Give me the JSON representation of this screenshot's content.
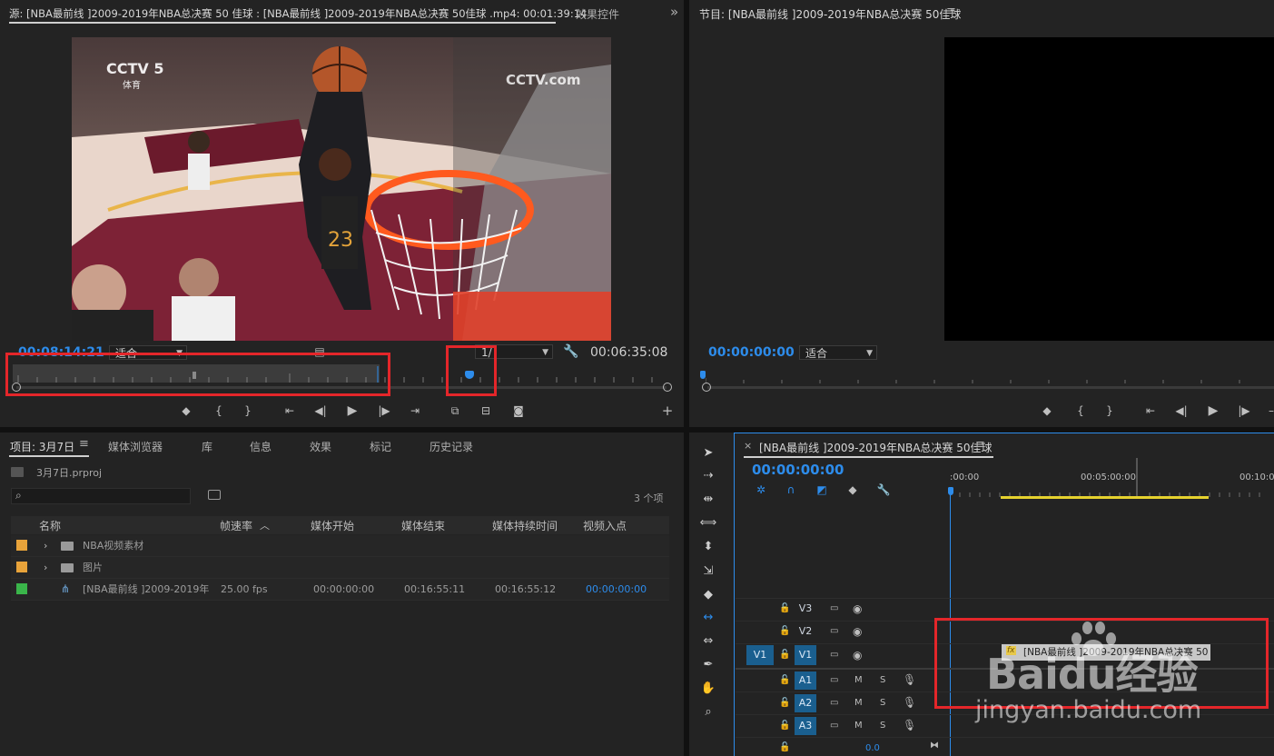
{
  "source_panel": {
    "tab_title": "源: [NBA最前线 ]2009-2019年NBA总决赛 50 佳球 : [NBA最前线 ]2009-2019年NBA总决赛 50佳球 .mp4: 00:01:39:14",
    "effects_tab": "效果控件",
    "expand_label": "»",
    "timecode_in": "00:08:14:21",
    "fit_label": "适合",
    "ratio_label": "1/",
    "duration": "00:06:35:08",
    "watermark_cctv": "CCTV 5",
    "watermark_sub": "体育",
    "watermark_com": "CCTV.com"
  },
  "program_panel": {
    "title": "节目: [NBA最前线 ]2009-2019年NBA总决赛 50佳球",
    "timecode": "00:00:00:00",
    "fit_label": "适合"
  },
  "project_panel": {
    "tabs": [
      "项目: 3月7日",
      "媒体浏览器",
      "库",
      "信息",
      "效果",
      "标记",
      "历史记录"
    ],
    "file_name": "3月7日.prproj",
    "search_placeholder": "",
    "item_count": "3 个项",
    "columns": [
      "名称",
      "帧速率",
      "媒体开始",
      "媒体结束",
      "媒体持续时间",
      "视频入点"
    ],
    "rows": [
      {
        "color": "#e8a33a",
        "name": "NBA视频素材",
        "fps": "",
        "start": "",
        "end": "",
        "dur": "",
        "in": "",
        "type": "folder"
      },
      {
        "color": "#e8a33a",
        "name": "图片",
        "fps": "",
        "start": "",
        "end": "",
        "dur": "",
        "in": "",
        "type": "folder"
      },
      {
        "color": "#3ab54a",
        "name": "[NBA最前线 ]2009-2019年",
        "fps": "25.00 fps",
        "start": "00:00:00:00",
        "end": "00:16:55:11",
        "dur": "00:16:55:12",
        "in": "00:00:00:00",
        "type": "clip"
      }
    ]
  },
  "timeline_panel": {
    "sequence_title": "[NBA最前线 ]2009-2019年NBA总决赛 50佳球",
    "close_label": "×",
    "timecode": "00:00:00:00",
    "ruler_labels": [
      ":00:00",
      "00:05:00:00",
      "00:10:0"
    ],
    "tracks_video": [
      "V3",
      "V2",
      "V1"
    ],
    "source_patch": "V1",
    "tracks_audio": [
      "A1",
      "A2",
      "A3"
    ],
    "mute_label": "M",
    "solo_label": "S",
    "clip_label": "[NBA最前线 ]2009-2019年NBA总决赛 50",
    "fx_label": "fx",
    "master_value": "0.0"
  },
  "watermark": {
    "brand": "Baidu经验",
    "url": "jingyan.baidu.com"
  },
  "colors": {
    "accent_blue": "#2d8ceb",
    "red_highlight": "#e4262a",
    "track_on": "#1a5f8f",
    "timeline_yellow": "#e6d22e"
  }
}
